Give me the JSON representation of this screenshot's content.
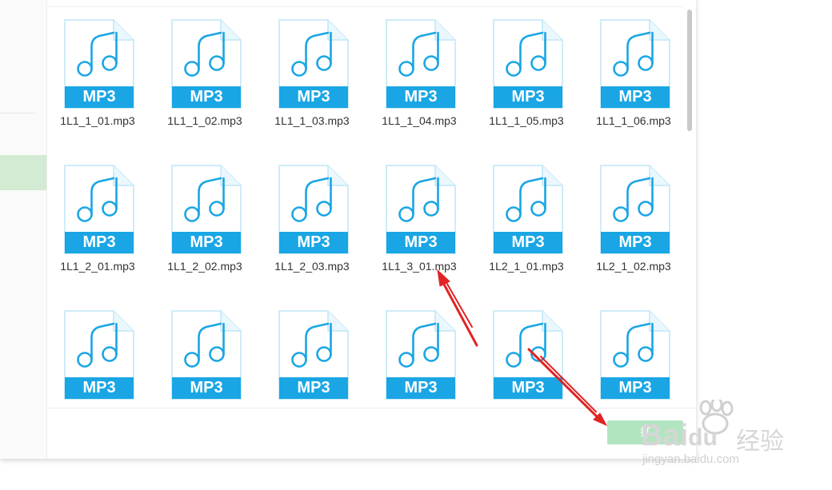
{
  "files": [
    {
      "name": "1L1_1_01.mp3",
      "type_label": "MP3"
    },
    {
      "name": "1L1_1_02.mp3",
      "type_label": "MP3"
    },
    {
      "name": "1L1_1_03.mp3",
      "type_label": "MP3"
    },
    {
      "name": "1L1_1_04.mp3",
      "type_label": "MP3"
    },
    {
      "name": "1L1_1_05.mp3",
      "type_label": "MP3"
    },
    {
      "name": "1L1_1_06.mp3",
      "type_label": "MP3"
    },
    {
      "name": "1L1_2_01.mp3",
      "type_label": "MP3"
    },
    {
      "name": "1L1_2_02.mp3",
      "type_label": "MP3"
    },
    {
      "name": "1L1_2_03.mp3",
      "type_label": "MP3"
    },
    {
      "name": "1L1_3_01.mp3",
      "type_label": "MP3"
    },
    {
      "name": "1L2_1_01.mp3",
      "type_label": "MP3"
    },
    {
      "name": "1L2_1_02.mp3",
      "type_label": "MP3"
    },
    {
      "name": "",
      "type_label": "MP3"
    },
    {
      "name": "",
      "type_label": "MP3"
    },
    {
      "name": "",
      "type_label": "MP3"
    },
    {
      "name": "",
      "type_label": "MP3"
    },
    {
      "name": "",
      "type_label": "MP3"
    },
    {
      "name": "",
      "type_label": "MP3"
    }
  ],
  "footer": {
    "confirm_label": "打"
  },
  "watermark": {
    "brand": "Bai",
    "brand_suffix": "du",
    "sub": "经验",
    "url": "jingyan.baidu.com"
  },
  "colors": {
    "icon_blue": "#1aa6e4",
    "arrow_red": "#e02424",
    "sidebar_selected": "#d2ebd2"
  },
  "icons": {
    "file_type": "music-note-icon"
  }
}
